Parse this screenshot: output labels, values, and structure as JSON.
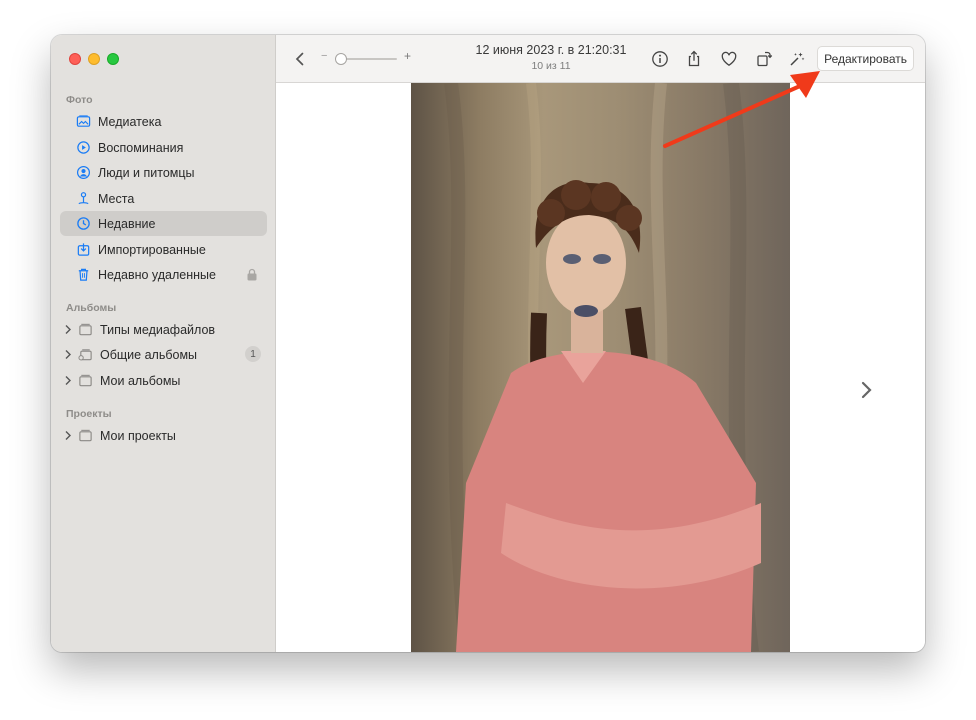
{
  "sidebar": {
    "sections": {
      "photos": "Фото",
      "albums": "Альбомы",
      "projects": "Проекты"
    },
    "items": [
      {
        "label": "Медиатека",
        "icon": "library-icon"
      },
      {
        "label": "Воспоминания",
        "icon": "memories-icon"
      },
      {
        "label": "Люди и питомцы",
        "icon": "people-icon"
      },
      {
        "label": "Места",
        "icon": "places-icon"
      },
      {
        "label": "Недавние",
        "icon": "recents-icon",
        "active": true
      },
      {
        "label": "Импортированные",
        "icon": "imports-icon"
      },
      {
        "label": "Недавно удаленные",
        "icon": "trash-icon"
      }
    ],
    "albums": [
      {
        "label": "Типы медиафайлов",
        "icon": "folder-icon"
      },
      {
        "label": "Общие альбомы",
        "icon": "shared-folder-icon",
        "badge": "1"
      },
      {
        "label": "Мои альбомы",
        "icon": "folder-icon"
      }
    ],
    "projects": [
      {
        "label": "Мои проекты",
        "icon": "folder-icon"
      }
    ]
  },
  "toolbar": {
    "date_title": "12 июня 2023 г. в 21:20:31",
    "position_text": "10 из 11",
    "zoom_minus": "−",
    "zoom_plus": "+",
    "edit_label": "Редактировать"
  },
  "colors": {
    "accent": "#1a7cf5",
    "annotation_arrow": "#f03a1a"
  }
}
